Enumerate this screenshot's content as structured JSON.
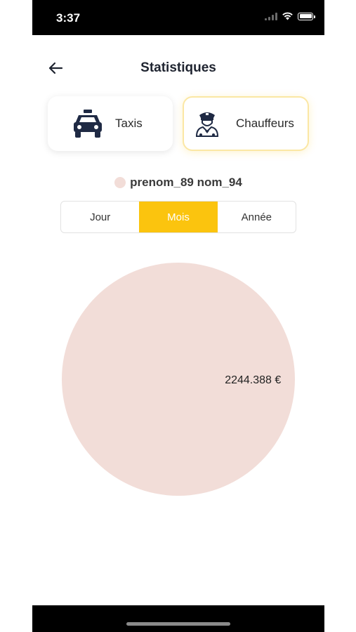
{
  "status_bar": {
    "time": "3:37"
  },
  "header": {
    "title": "Statistiques"
  },
  "tabs": [
    {
      "label": "Taxis",
      "icon": "car-icon",
      "selected": false
    },
    {
      "label": "Chauffeurs",
      "icon": "driver-icon",
      "selected": true
    }
  ],
  "legend": {
    "label": "prenom_89 nom_94",
    "color": "#f2ddd8"
  },
  "periods": {
    "options": [
      "Jour",
      "Mois",
      "Année"
    ],
    "selected": "Mois",
    "active_color": "#fbc40e"
  },
  "chart_data": {
    "type": "pie",
    "categories": [
      "prenom_89 nom_94"
    ],
    "values": [
      2244.388
    ],
    "labels": [
      "2244.388 €"
    ],
    "colors": [
      "#f2ddd8"
    ]
  }
}
